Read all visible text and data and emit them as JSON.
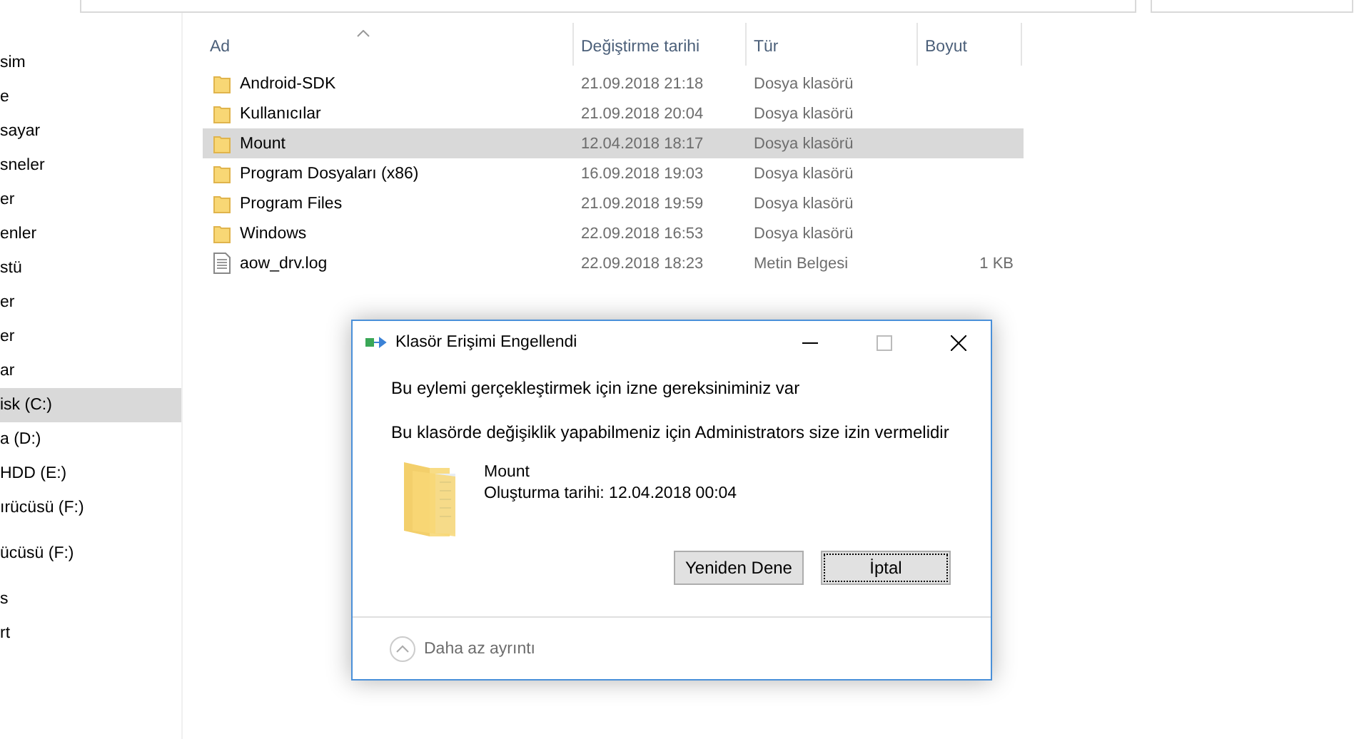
{
  "sidebar": {
    "groups": [
      [
        {
          "label": "sim",
          "selected": false
        },
        {
          "label": "e",
          "selected": false
        },
        {
          "label": "sayar",
          "selected": false
        },
        {
          "label": "sneler",
          "selected": false
        },
        {
          "label": "er",
          "selected": false
        },
        {
          "label": "enler",
          "selected": false
        },
        {
          "label": "stü",
          "selected": false
        },
        {
          "label": "er",
          "selected": false
        },
        {
          "label": "er",
          "selected": false
        },
        {
          "label": "ar",
          "selected": false
        },
        {
          "label": "isk (C:)",
          "selected": true
        },
        {
          "label": "a (D:)",
          "selected": false
        },
        {
          "label": "HDD (E:)",
          "selected": false
        },
        {
          "label": "ırücüsü (F:)",
          "selected": false
        }
      ],
      [
        {
          "label": "ücüsü (F:)",
          "selected": false
        }
      ],
      [
        {
          "label": "s",
          "selected": false
        },
        {
          "label": "rt",
          "selected": false
        }
      ]
    ]
  },
  "table": {
    "columns": [
      "Ad",
      "Değiştirme tarihi",
      "Tür",
      "Boyut"
    ],
    "rows": [
      {
        "kind": "folder",
        "name": "Android-SDK",
        "date": "21.09.2018 21:18",
        "type": "Dosya klasörü",
        "selected": false
      },
      {
        "kind": "folder",
        "name": "Kullanıcılar",
        "date": "21.09.2018 20:04",
        "type": "Dosya klasörü",
        "selected": false
      },
      {
        "kind": "folder",
        "name": "Mount",
        "date": "12.04.2018 18:17",
        "type": "Dosya klasörü",
        "selected": true
      },
      {
        "kind": "folder",
        "name": "Program Dosyaları (x86)",
        "date": "16.09.2018 19:03",
        "type": "Dosya klasörü",
        "selected": false
      },
      {
        "kind": "folder",
        "name": "Program Files",
        "date": "21.09.2018 19:59",
        "type": "Dosya klasörü",
        "selected": false
      },
      {
        "kind": "folder",
        "name": "Windows",
        "date": "22.09.2018 16:53",
        "type": "Dosya klasörü",
        "selected": false
      },
      {
        "kind": "file",
        "name": "aow_drv.log",
        "date": "22.09.2018 18:23",
        "type": "Metin Belgesi",
        "size": "1 KB",
        "selected": false
      }
    ]
  },
  "dialog": {
    "title": "Klasör Erişimi Engellendi",
    "message": "Bu eylemi gerçekleştirmek için izne gereksiniminiz var",
    "detail": "Bu klasörde değişiklik yapabilmeniz için Administrators size izin vermelidir",
    "item_name": "Mount",
    "item_created": "Oluşturma tarihi: 12.04.2018 00:04",
    "buttons": [
      {
        "label": "Yeniden Dene",
        "focused": false
      },
      {
        "label": "İptal",
        "focused": true
      }
    ],
    "details_toggle": "Daha az ayrıntı"
  }
}
